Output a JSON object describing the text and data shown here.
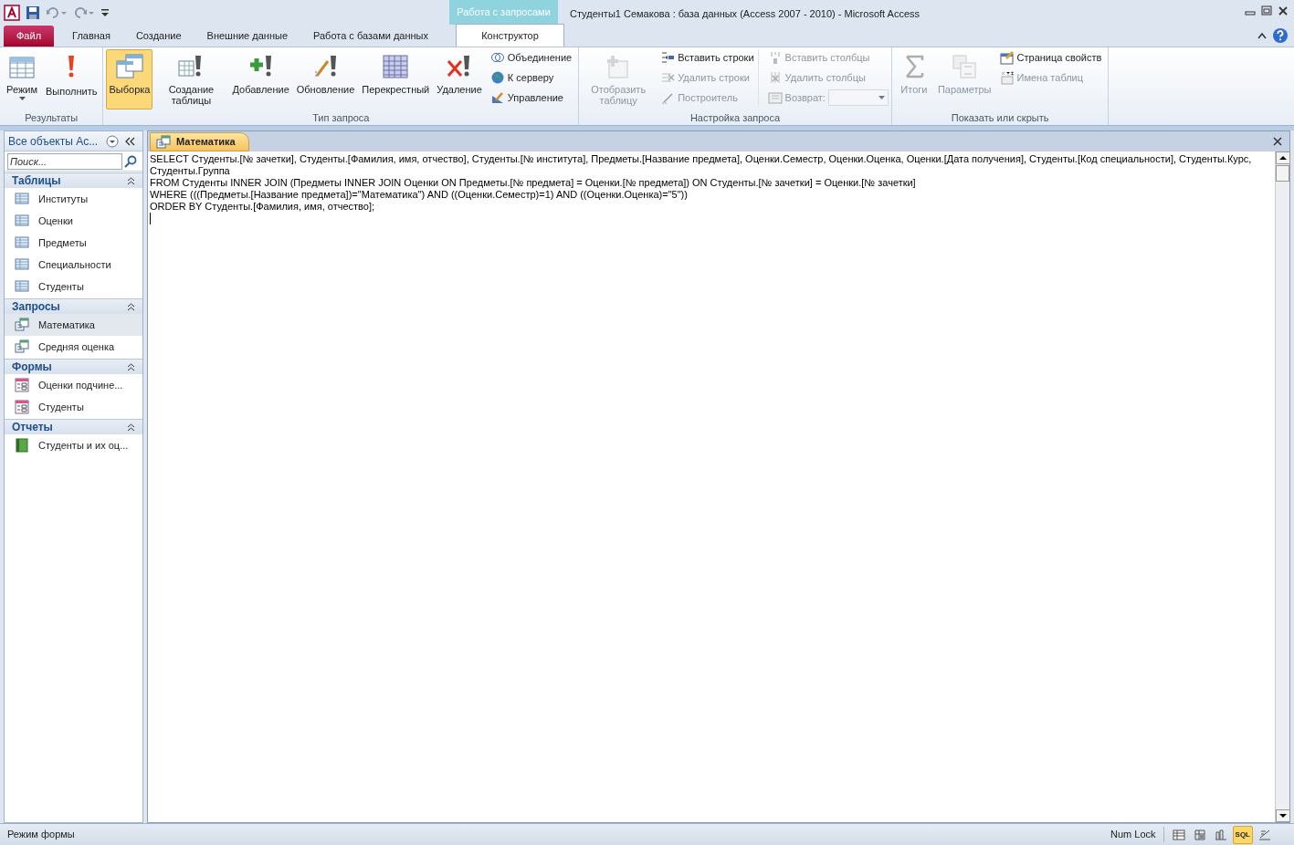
{
  "window": {
    "title": "Студенты1 Семакова : база данных (Access 2007 - 2010)  -  Microsoft Access",
    "context_tab": "Работа с запросами"
  },
  "ribbon_tabs": [
    {
      "label": "Файл",
      "kind": "file",
      "selected": false
    },
    {
      "label": "Главная",
      "kind": "normal",
      "selected": false
    },
    {
      "label": "Создание",
      "kind": "normal",
      "selected": false
    },
    {
      "label": "Внешние данные",
      "kind": "normal",
      "selected": false
    },
    {
      "label": "Работа с базами данных",
      "kind": "normal",
      "selected": false
    },
    {
      "label": "Конструктор",
      "kind": "context",
      "selected": true
    }
  ],
  "ribbon_groups": [
    {
      "label": "Результаты",
      "items": [
        {
          "label": "Режим",
          "kind": "large_dropdown",
          "disabled": false,
          "selected": false
        },
        {
          "label": "Выполнить",
          "kind": "large",
          "disabled": false,
          "selected": false
        }
      ]
    },
    {
      "label": "Тип запроса",
      "items": [
        {
          "label": "Выборка",
          "kind": "large",
          "disabled": false,
          "selected": true
        },
        {
          "label": "Создание таблицы",
          "kind": "large",
          "disabled": false,
          "selected": false
        },
        {
          "label": "Добавление",
          "kind": "large",
          "disabled": false,
          "selected": false
        },
        {
          "label": "Обновление",
          "kind": "large",
          "disabled": false,
          "selected": false
        },
        {
          "label": "Перекрестный",
          "kind": "large",
          "disabled": false,
          "selected": false
        },
        {
          "label": "Удаление",
          "kind": "large",
          "disabled": false,
          "selected": false
        },
        {
          "label": "Объединение",
          "kind": "small",
          "disabled": false
        },
        {
          "label": "К серверу",
          "kind": "small",
          "disabled": false
        },
        {
          "label": "Управление",
          "kind": "small",
          "disabled": false
        }
      ]
    },
    {
      "label": "Настройка запроса",
      "items": [
        {
          "label": "Отобразить таблицу",
          "kind": "large",
          "disabled": true,
          "selected": false
        },
        {
          "label": "Вставить строки",
          "kind": "small",
          "disabled": false
        },
        {
          "label": "Удалить строки",
          "kind": "small",
          "disabled": true
        },
        {
          "label": "Построитель",
          "kind": "small",
          "disabled": true
        },
        {
          "label": "Вставить столбцы",
          "kind": "small",
          "disabled": true
        },
        {
          "label": "Удалить столбцы",
          "kind": "small",
          "disabled": true
        },
        {
          "label": "Возврат:",
          "kind": "combo",
          "disabled": true
        }
      ]
    },
    {
      "label": "Показать или скрыть",
      "items": [
        {
          "label": "Итоги",
          "kind": "large",
          "disabled": true,
          "selected": false
        },
        {
          "label": "Параметры",
          "kind": "large",
          "disabled": true,
          "selected": false
        },
        {
          "label": "Страница свойств",
          "kind": "small",
          "disabled": false
        },
        {
          "label": "Имена таблиц",
          "kind": "small",
          "disabled": true
        }
      ]
    }
  ],
  "nav_pane": {
    "title": "Все объекты Ac...",
    "search": {
      "placeholder": "Поиск..."
    },
    "sections": [
      {
        "label": "Таблицы",
        "items": [
          {
            "label": "Институты",
            "kind": "table",
            "selected": false
          },
          {
            "label": "Оценки",
            "kind": "table",
            "selected": false
          },
          {
            "label": "Предметы",
            "kind": "table",
            "selected": false
          },
          {
            "label": "Специальности",
            "kind": "table",
            "selected": false
          },
          {
            "label": "Студенты",
            "kind": "table",
            "selected": false
          }
        ]
      },
      {
        "label": "Запросы",
        "items": [
          {
            "label": "Математика",
            "kind": "query",
            "selected": true
          },
          {
            "label": "Средняя оценка",
            "kind": "query",
            "selected": false
          }
        ]
      },
      {
        "label": "Формы",
        "items": [
          {
            "label": "Оценки подчине...",
            "kind": "form",
            "selected": false
          },
          {
            "label": "Студенты",
            "kind": "form",
            "selected": false
          }
        ]
      },
      {
        "label": "Отчеты",
        "items": [
          {
            "label": "Студенты и их оц...",
            "kind": "report",
            "selected": false
          }
        ]
      }
    ]
  },
  "document_tab": {
    "label": "Математика"
  },
  "sql_lines": [
    "SELECT Студенты.[№ зачетки], Студенты.[Фамилия, имя, отчество], Студенты.[№ института], Предметы.[Название предмета], Оценки.Семестр, Оценки.Оценка, Оценки.[Дата получения], Студенты.[Код специальности], Студенты.Курс, Студенты.Группа",
    "FROM Студенты INNER JOIN (Предметы INNER JOIN Оценки ON Предметы.[№ предмета] = Оценки.[№ предмета]) ON Студенты.[№ зачетки] = Оценки.[№ зачетки]",
    "WHERE (((Предметы.[Название предмета])=\"Математика\") AND ((Оценки.Семестр)=1) AND ((Оценки.Оценка)=\"5\"))",
    "ORDER BY Студенты.[Фамилия, имя, отчество];"
  ],
  "status_bar": {
    "text": "Режим формы",
    "indicator": "Num Lock",
    "views": [
      {
        "kind": "datasheet",
        "selected": false
      },
      {
        "kind": "pivot_table",
        "selected": false
      },
      {
        "kind": "pivot_chart",
        "selected": false
      },
      {
        "kind": "sql",
        "label": "SQL",
        "selected": true
      },
      {
        "kind": "design",
        "selected": false
      }
    ]
  }
}
